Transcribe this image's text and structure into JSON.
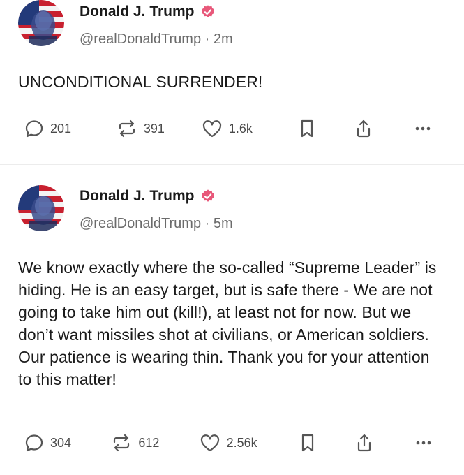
{
  "posts": [
    {
      "author": {
        "name": "Donald J. Trump",
        "handle": "@realDonaldTrump",
        "verified": true
      },
      "time": "· 2m",
      "text": "UNCONDITIONAL SURRENDER!",
      "stats": {
        "replies": "201",
        "reposts": "391",
        "likes": "1.6k"
      }
    },
    {
      "author": {
        "name": "Donald J. Trump",
        "handle": "@realDonaldTrump",
        "verified": true
      },
      "time": "· 5m",
      "text": "We know exactly where the so-called “Supreme Leader” is hiding. He is an easy target, but is safe there - We are not going to take him out (kill!), at least not for now. But we don’t want missiles shot at civilians, or American soldiers. Our patience is wearing thin. Thank you for your attention to this matter!",
      "stats": {
        "replies": "304",
        "reposts": "612",
        "likes": "2.56k"
      }
    }
  ],
  "icons": {
    "reply": "speech-bubble-icon",
    "repost": "repost-arrows-icon",
    "like": "heart-icon",
    "bookmark": "bookmark-icon",
    "share": "share-icon",
    "more": "more-dots-icon",
    "verified": "verified-badge-icon"
  },
  "colors": {
    "verified_badge": "#e8587a",
    "icon": "#555555",
    "handle": "#6b6b6b"
  }
}
